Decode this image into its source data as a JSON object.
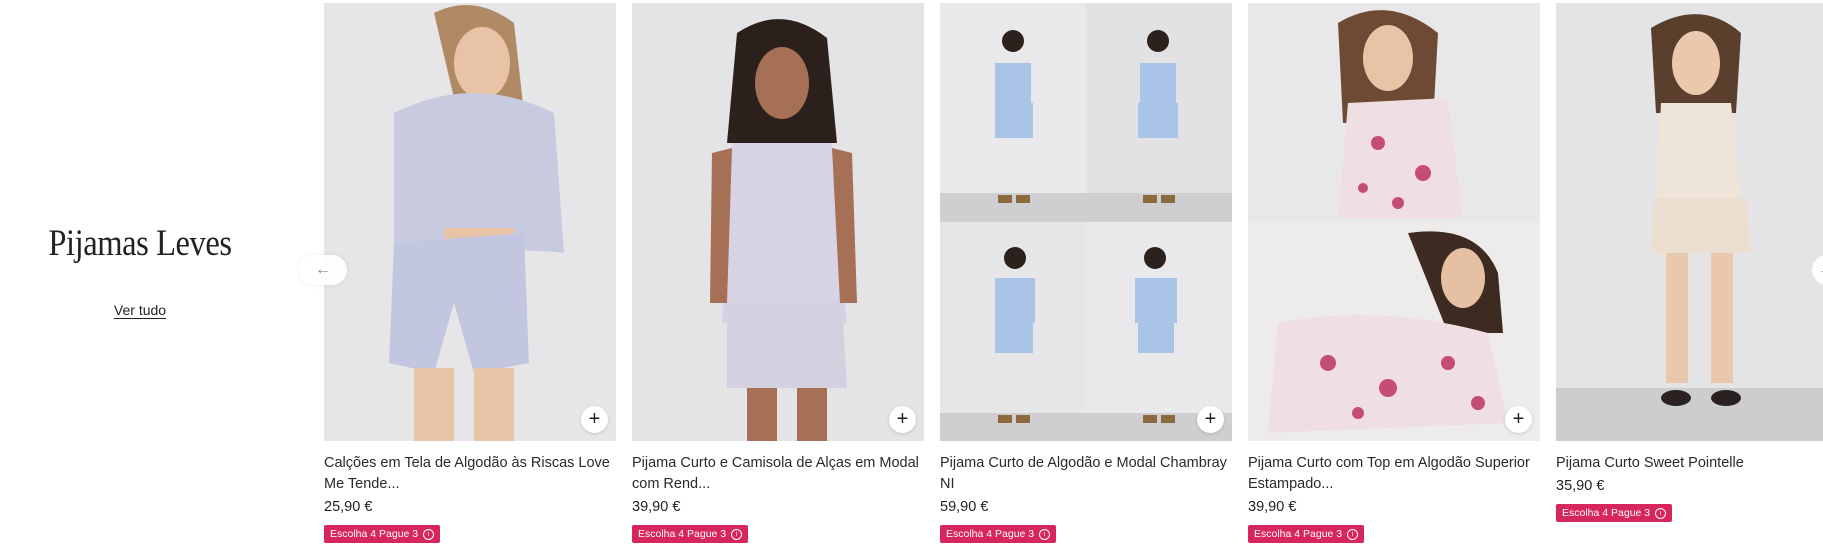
{
  "section": {
    "title": "Pijamas Leves",
    "see_all_label": "Ver tudo"
  },
  "navigation": {
    "prev_icon": "arrow-left-icon",
    "next_icon": "arrow-right-icon"
  },
  "colors": {
    "promo_badge": "#d6265c",
    "image_background": "#e7e7e9"
  },
  "products": [
    {
      "name": "Calções em Tela de Algodão às Riscas Love Me Tende...",
      "price": "25,90 €",
      "promo": "Escolha 4 Pague 3",
      "add_icon": "plus-icon"
    },
    {
      "name": "Pijama Curto e Camisola de Alças em Modal com Rend...",
      "price": "39,90 €",
      "promo": "Escolha 4 Pague 3",
      "add_icon": "plus-icon"
    },
    {
      "name": "Pijama Curto de Algodão e Modal Chambray NI",
      "price": "59,90 €",
      "promo": "Escolha 4 Pague 3",
      "add_icon": "plus-icon"
    },
    {
      "name": "Pijama Curto com Top em Algodão Superior Estampado...",
      "price": "39,90 €",
      "promo": "Escolha 4 Pague 3",
      "add_icon": "plus-icon"
    },
    {
      "name": "Pijama Curto Sweet Pointelle",
      "price": "35,90 €",
      "promo": "Escolha 4 Pague 3",
      "add_icon": "plus-icon"
    }
  ]
}
